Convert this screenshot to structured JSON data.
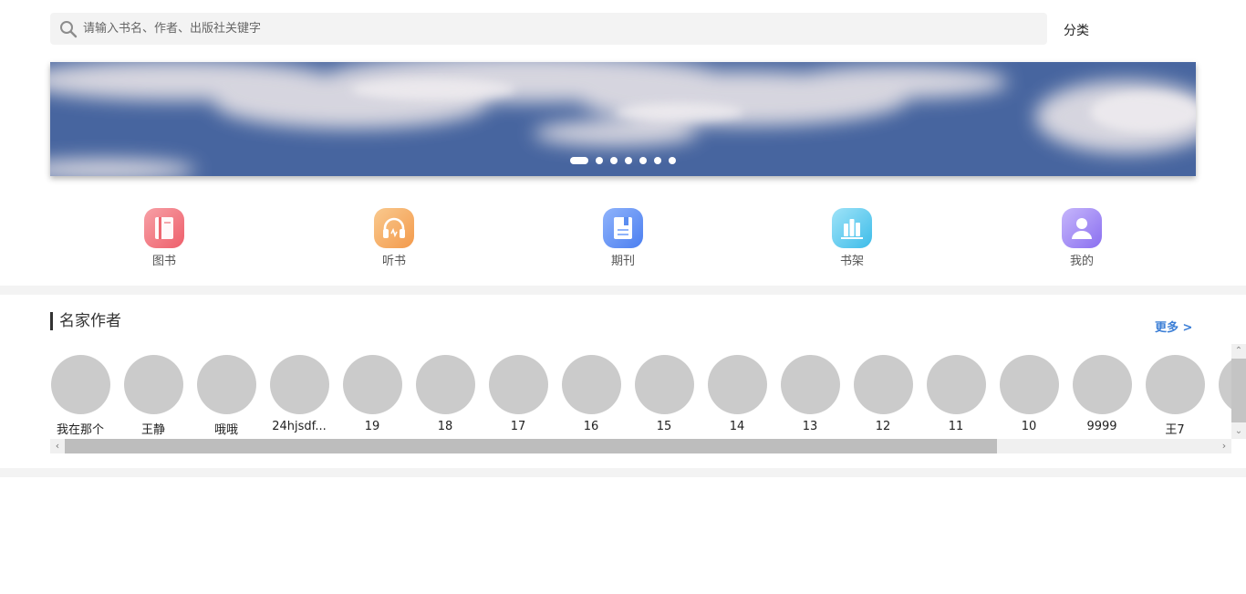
{
  "search": {
    "placeholder": "请输入书名、作者、出版社关键字",
    "value": ""
  },
  "category_link": "分类",
  "banner": {
    "dots_count": 7,
    "active_index": 0
  },
  "nav": [
    {
      "label": "图书",
      "icon": "book-icon",
      "color": "#f0707a"
    },
    {
      "label": "听书",
      "icon": "headphones-icon",
      "color": "#f5a55f"
    },
    {
      "label": "期刊",
      "icon": "journal-icon",
      "color": "#5b8df0"
    },
    {
      "label": "书架",
      "icon": "bookshelf-icon",
      "color": "#4ec6ef"
    },
    {
      "label": "我的",
      "icon": "user-icon",
      "color": "#9b82ef"
    }
  ],
  "authors_section": {
    "title": "名家作者",
    "more": "更多 >",
    "authors": [
      "我在那个",
      "王静",
      "哦哦",
      "24hjsdf...",
      "19",
      "18",
      "17",
      "16",
      "15",
      "14",
      "13",
      "12",
      "11",
      "10",
      "9999",
      "王7",
      ""
    ]
  },
  "colors": {
    "accent": "#3d7fd6",
    "avatar_placeholder": "#cbcbcb",
    "separator": "#f3f3f3"
  }
}
